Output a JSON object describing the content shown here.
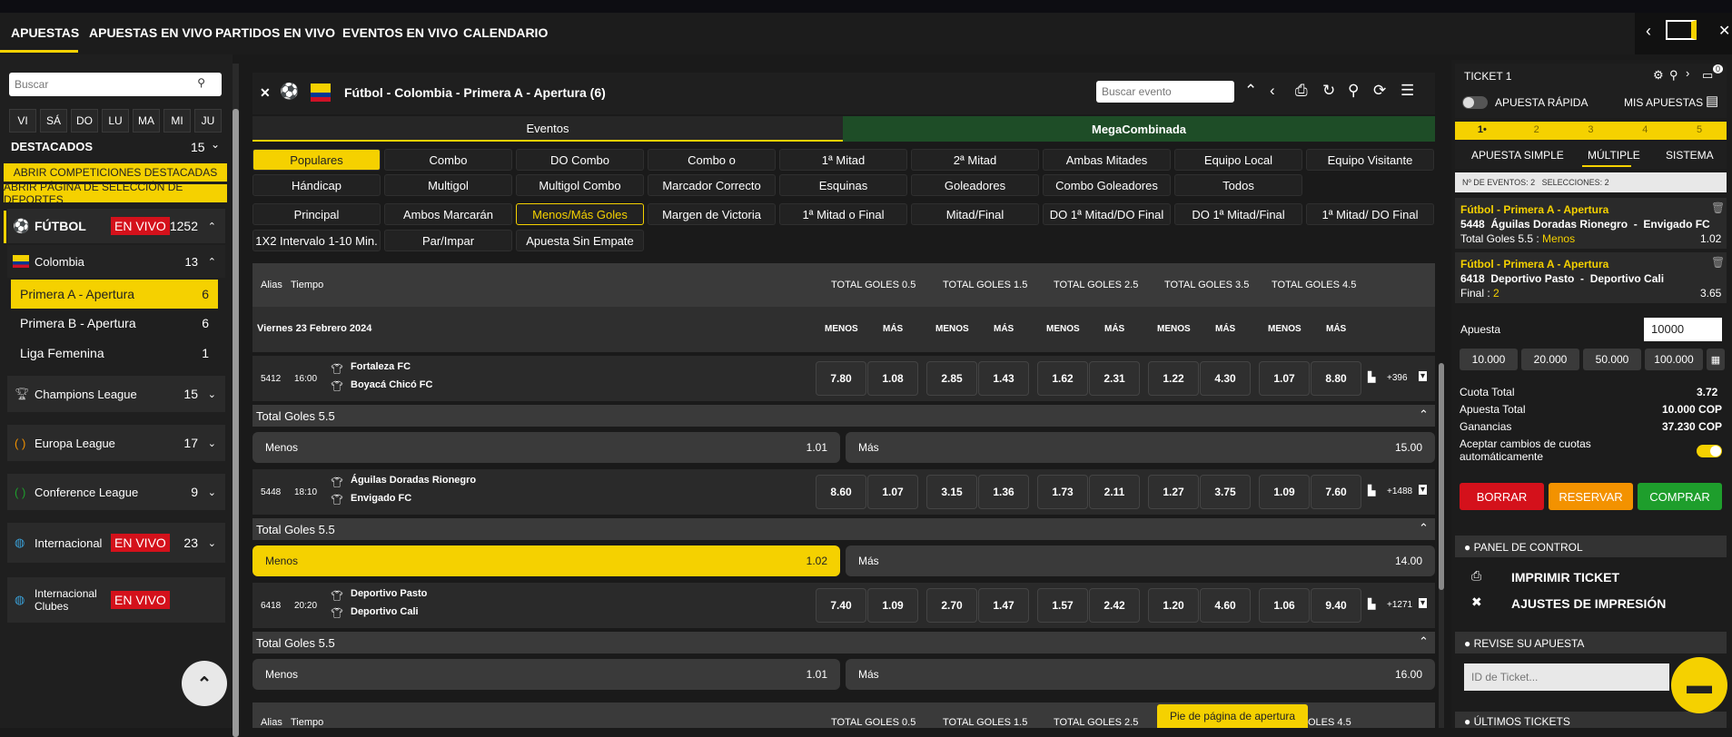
{
  "nav": {
    "items": [
      "APUESTAS",
      "APUESTAS EN VIVO",
      "PARTIDOS EN VIVO",
      "EVENTOS EN VIVO",
      "CALENDARIO"
    ]
  },
  "sidebar": {
    "search_placeholder": "Buscar",
    "days": [
      "VI",
      "SÁ",
      "DO",
      "LU",
      "MA",
      "MI",
      "JU"
    ],
    "featured_label": "DESTACADOS",
    "featured_count": "15",
    "btn_competitions": "ABRIR COMPETICIONES DESTACADAS",
    "btn_sports_page": "ABRIR PÁGINA DE SELECCIÓN DE DEPORTES",
    "live_label": "EN VIVO",
    "sports": [
      {
        "label": "FÚTBOL",
        "count": "1252"
      },
      {
        "label": "Colombia",
        "count": "13"
      },
      {
        "label": "Champions League",
        "count": "15"
      },
      {
        "label": "Europa League",
        "count": "17"
      },
      {
        "label": "Conference League",
        "count": "9"
      },
      {
        "label": "Internacional",
        "count": "23"
      },
      {
        "label": "Internacional Clubes",
        "count": ""
      }
    ],
    "leagues": [
      {
        "label": "Primera A - Apertura",
        "count": "6"
      },
      {
        "label": "Primera B - Apertura",
        "count": "6"
      },
      {
        "label": "Liga Femenina",
        "count": "1"
      }
    ]
  },
  "event": {
    "title": "Fútbol - Colombia - Primera A - Apertura (6)",
    "search_placeholder": "Buscar evento",
    "tab_events": "Eventos",
    "tab_mega": "MegaCombinada",
    "filters_row1": [
      "Populares",
      "Combo",
      "DO Combo",
      "Combo o",
      "1ª Mitad",
      "2ª Mitad",
      "Ambas Mitades",
      "Equipo Local",
      "Equipo Visitante"
    ],
    "filters_row2": [
      "Hándicap",
      "Multigol",
      "Multigol Combo",
      "Marcador Correcto",
      "Esquinas",
      "Goleadores",
      "Combo Goleadores",
      "Todos"
    ],
    "filters_row3": [
      "Principal",
      "Ambos Marcarán",
      "Menos/Más Goles",
      "Margen de Victoria",
      "1ª Mitad o Final",
      "Mitad/Final",
      "DO 1ª Mitad/DO Final",
      "DO 1ª Mitad/Final",
      "1ª Mitad/ DO Final"
    ],
    "filters_row4": [
      "1X2 Intervalo 1-10 Min.",
      "Par/Impar",
      "Apuesta Sin Empate"
    ],
    "col_alias": "Alias",
    "col_time": "Tiempo",
    "totals": [
      "TOTAL GOLES 0.5",
      "TOTAL GOLES 1.5",
      "TOTAL GOLES 2.5",
      "TOTAL GOLES 3.5",
      "TOTAL GOLES 4.5"
    ],
    "totals_partial": [
      "TOTAL GOLES 0.5",
      "TOTAL GOLES 1.5",
      "TOTAL GOLES 2.5",
      "OLES 4.5"
    ],
    "date_label": "Viernes 23 Febrero 2024",
    "menos": "MENOS",
    "mas": "MÁS",
    "matches": [
      {
        "alias": "5412",
        "time": "16:00",
        "home": "Fortaleza FC",
        "away": "Boyacá Chicó FC",
        "odds": [
          "7.80",
          "1.08",
          "2.85",
          "1.43",
          "1.62",
          "2.31",
          "1.22",
          "4.30",
          "1.07",
          "8.80"
        ],
        "more": "+396",
        "group": "Total Goles 5.5",
        "menos_label": "Menos",
        "menos_odd": "1.01",
        "mas_label": "Más",
        "mas_odd": "15.00"
      },
      {
        "alias": "5448",
        "time": "18:10",
        "home": "Águilas Doradas Rionegro",
        "away": "Envigado FC",
        "odds": [
          "8.60",
          "1.07",
          "3.15",
          "1.36",
          "1.73",
          "2.11",
          "1.27",
          "3.75",
          "1.09",
          "7.60"
        ],
        "more": "+1488",
        "group": "Total Goles 5.5",
        "menos_label": "Menos",
        "menos_odd": "1.02",
        "mas_label": "Más",
        "mas_odd": "14.00"
      },
      {
        "alias": "6418",
        "time": "20:20",
        "home": "Deportivo Pasto",
        "away": "Deportivo Cali",
        "odds": [
          "7.40",
          "1.09",
          "2.70",
          "1.47",
          "1.57",
          "2.42",
          "1.20",
          "4.60",
          "1.06",
          "9.40"
        ],
        "more": "+1271",
        "group": "Total Goles 5.5",
        "menos_label": "Menos",
        "menos_odd": "1.01",
        "mas_label": "Más",
        "mas_odd": "16.00"
      }
    ],
    "footer_btn": "Pie de página de apertura"
  },
  "ticket": {
    "title": "TICKET 1",
    "badge": "0",
    "quick_bet": "APUESTA RÁPIDA",
    "my_bets": "MIS APUESTAS",
    "slots": [
      "1•",
      "2",
      "3",
      "4",
      "5"
    ],
    "tabs": [
      "APUESTA SIMPLE",
      "MÚLTIPLE",
      "SISTEMA"
    ],
    "summary": "Nº DE EVENTOS: 2   SELECCIONES: 2",
    "bets": [
      {
        "league": "Fútbol - Primera A - Apertura",
        "match": "5448  Águilas Doradas Rionegro  -  Envigado FC",
        "market": "Total Goles 5.5 : ",
        "pick": "Menos",
        "odd": "1.02"
      },
      {
        "league": "Fútbol - Primera A - Apertura",
        "match": "6418  Deportivo Pasto  -  Deportivo Cali",
        "market": "Final : ",
        "pick": "2",
        "odd": "3.65"
      }
    ],
    "stake_label": "Apuesta",
    "stake_value": "10000",
    "amounts": [
      "10.000",
      "20.000",
      "50.000",
      "100.000"
    ],
    "cuota_label": "Cuota Total",
    "cuota_value": "3.72",
    "apuesta_total_label": "Apuesta Total",
    "apuesta_total_value": "10.000 COP",
    "ganancias_label": "Ganancias",
    "ganancias_value": "37.230 COP",
    "accept_label": "Aceptar cambios de cuotas automáticamente",
    "btn_borrar": "BORRAR",
    "btn_reservar": "RESERVAR",
    "btn_comprar": "COMPRAR",
    "panel_control": "PANEL DE CONTROL",
    "print_ticket": "IMPRIMIR TICKET",
    "print_settings": "AJUSTES DE IMPRESIÓN",
    "review": "REVISE SU APUESTA",
    "ticket_id_placeholder": "ID de Ticket...",
    "last_tickets": "ÚLTIMOS TICKETS"
  },
  "colors": {
    "accent": "#f5d100",
    "live": "#d4111b",
    "buy": "#1e9e2c",
    "reserve": "#f39200",
    "mega_bg": "#1e4d27"
  }
}
